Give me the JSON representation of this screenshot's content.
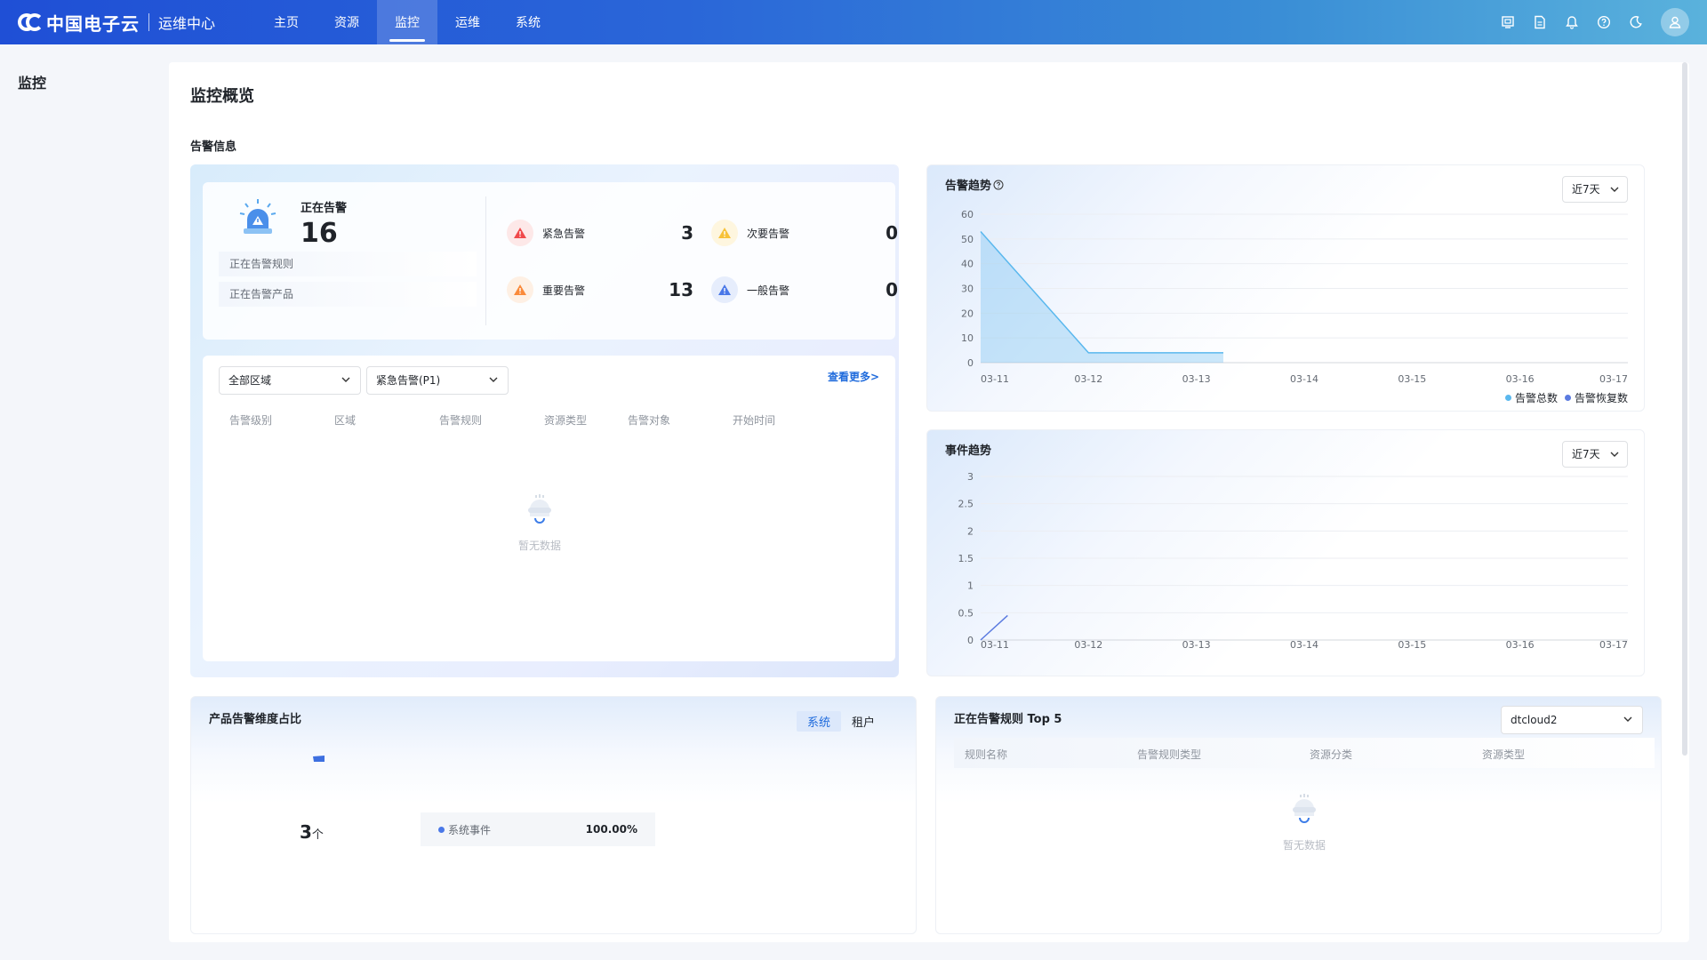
{
  "brand": {
    "name": "中国电子云",
    "sub": "运维中心"
  },
  "nav": [
    {
      "label": "主页",
      "active": false
    },
    {
      "label": "资源",
      "active": false
    },
    {
      "label": "监控",
      "active": true
    },
    {
      "label": "运维",
      "active": false
    },
    {
      "label": "系统",
      "active": false
    }
  ],
  "top_icons": [
    "screen-icon",
    "document-icon",
    "bell-icon",
    "help-icon",
    "moon-icon",
    "user-icon"
  ],
  "sidebar": {
    "title": "监控"
  },
  "page": {
    "title": "监控概览",
    "section": "告警信息"
  },
  "alarm_summary": {
    "label": "正在告警",
    "count": "16",
    "rules_label": "正在告警规则",
    "products_label": "正在告警产品",
    "severities": [
      {
        "label": "紧急告警",
        "value": "3",
        "color": "#f0494b"
      },
      {
        "label": "次要告警",
        "value": "0",
        "color": "#f7c239"
      },
      {
        "label": "重要告警",
        "value": "13",
        "color": "#fa8a3a"
      },
      {
        "label": "一般告警",
        "value": "0",
        "color": "#4a78e8"
      }
    ]
  },
  "alarm_list": {
    "region_select": "全部区域",
    "level_select": "紧急告警(P1)",
    "more_link": "查看更多>",
    "columns": [
      "告警级别",
      "区域",
      "告警规则",
      "资源类型",
      "告警对象",
      "开始时间"
    ],
    "empty_text": "暂无数据"
  },
  "alarm_trend": {
    "title": "告警趋势",
    "range": "近7天",
    "legend": [
      {
        "name": "告警总数",
        "color": "#5ab8ee"
      },
      {
        "name": "告警恢复数",
        "color": "#5b7be0"
      }
    ]
  },
  "event_trend": {
    "title": "事件趋势",
    "range": "近7天"
  },
  "chart_data": [
    {
      "type": "area",
      "title": "告警趋势",
      "categories": [
        "03-11",
        "03-12",
        "03-13",
        "03-14",
        "03-15",
        "03-16",
        "03-17"
      ],
      "ylim": [
        0,
        60
      ],
      "yticks": [
        0,
        10,
        20,
        30,
        40,
        50,
        60
      ],
      "series": [
        {
          "name": "告警总数",
          "x": [
            0,
            1,
            2.25
          ],
          "values": [
            53,
            4,
            4
          ]
        },
        {
          "name": "告警恢复数",
          "values": []
        }
      ],
      "grid": true,
      "legend": "bottom-right"
    },
    {
      "type": "line",
      "title": "事件趋势",
      "categories": [
        "03-11",
        "03-12",
        "03-13",
        "03-14",
        "03-15",
        "03-16",
        "03-17"
      ],
      "ylim": [
        0,
        3
      ],
      "yticks": [
        "0",
        "0.5",
        "1",
        "1.5",
        "2",
        "2.5",
        "3"
      ],
      "series": [
        {
          "x": [
            0,
            0.25
          ],
          "values": [
            0,
            0.45
          ]
        }
      ],
      "grid": true
    }
  ],
  "product_ratio": {
    "title": "产品告警维度占比",
    "tabs": [
      {
        "label": "系统",
        "active": true
      },
      {
        "label": "租户",
        "active": false
      }
    ],
    "count": "3",
    "unit": "个",
    "items": [
      {
        "label": "系统事件",
        "percent": "100.00%",
        "color": "#4a78e8"
      }
    ]
  },
  "top_rules": {
    "title": "正在告警规则 Top 5",
    "select": "dtcloud2",
    "columns": [
      "规则名称",
      "告警规则类型",
      "资源分类",
      "资源类型"
    ],
    "empty_text": "暂无数据"
  }
}
